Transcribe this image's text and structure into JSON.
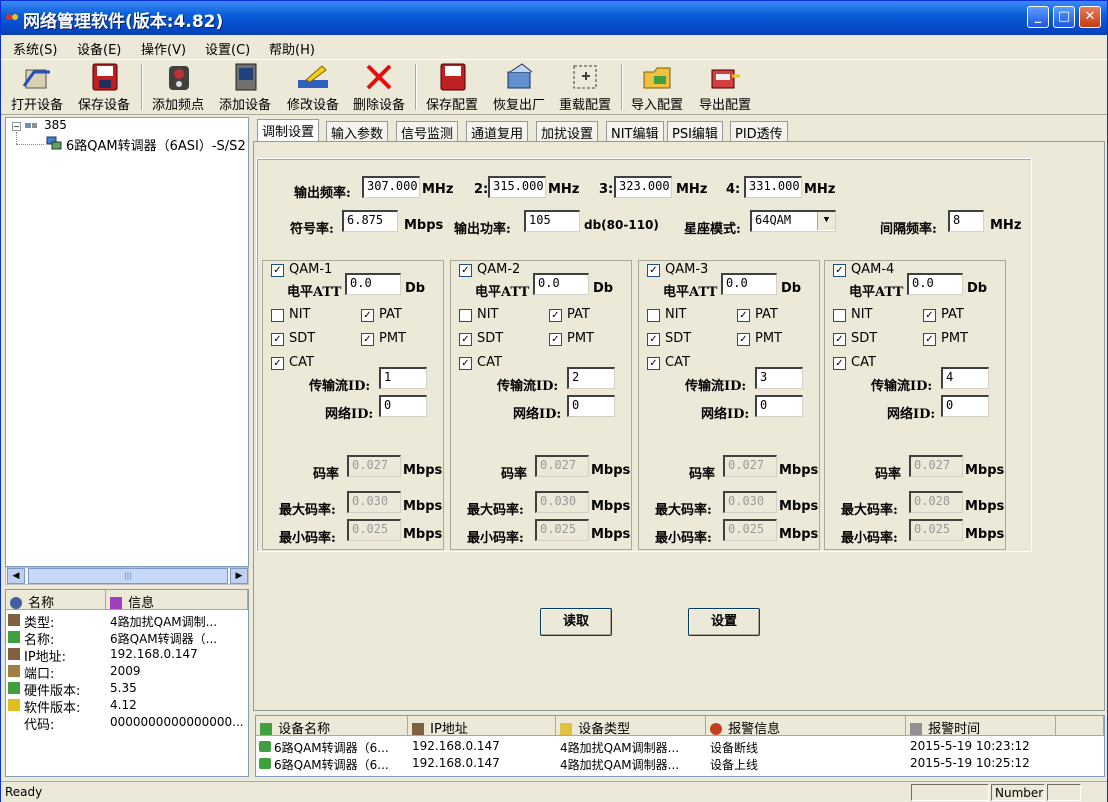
{
  "window": {
    "title": "网络管理软件(版本:4.82)"
  },
  "menu": [
    "系统(S)",
    "设备(E)",
    "操作(V)",
    "设置(C)",
    "帮助(H)"
  ],
  "toolbar": [
    "打开设备",
    "保存设备",
    "添加频点",
    "添加设备",
    "修改设备",
    "删除设备",
    "保存配置",
    "恢复出厂",
    "重载配置",
    "导入配置",
    "导出配置"
  ],
  "tree": {
    "root": "385",
    "child": "6路QAM转调器（6ASI）-S/S2"
  },
  "props": {
    "header": [
      "名称",
      "信息"
    ],
    "rows": [
      {
        "k": "类型:",
        "v": "4路加扰QAM调制..."
      },
      {
        "k": "名称:",
        "v": "6路QAM转调器（..."
      },
      {
        "k": "IP地址:",
        "v": "192.168.0.147"
      },
      {
        "k": "端口:",
        "v": "2009"
      },
      {
        "k": "硬件版本:",
        "v": "5.35"
      },
      {
        "k": "软件版本:",
        "v": "4.12"
      },
      {
        "k": "代码:",
        "v": "0000000000000000..."
      }
    ]
  },
  "tabs": [
    "调制设置",
    "输入参数",
    "信号监测",
    "通道复用",
    "加扰设置",
    "NIT编辑",
    "PSI编辑",
    "PID透传"
  ],
  "form": {
    "out_freq_label": "输出频率:",
    "f1": "307.000",
    "f2": "315.000",
    "f3": "323.000",
    "f4": "331.000",
    "n2": "2:",
    "n3": "3:",
    "n4": "4:",
    "mhz": "MHz",
    "sym_label": "符号率:",
    "sym": "6.875",
    "mbps": "Mbps",
    "power_label": "输出功率:",
    "power": "105",
    "power_unit": "db(80-110)",
    "const_label": "星座模式:",
    "const": "64QAM",
    "spacing_label": "间隔频率:",
    "spacing": "8"
  },
  "groups": [
    {
      "name": "QAM-1",
      "att": "0.0",
      "nit": false,
      "pat": true,
      "sdt": true,
      "pmt": true,
      "cat": true,
      "tsid": "1",
      "netid": "0",
      "rate": "0.027",
      "max": "0.030",
      "min": "0.025"
    },
    {
      "name": "QAM-2",
      "att": "0.0",
      "nit": false,
      "pat": true,
      "sdt": true,
      "pmt": true,
      "cat": true,
      "tsid": "2",
      "netid": "0",
      "rate": "0.027",
      "max": "0.030",
      "min": "0.025"
    },
    {
      "name": "QAM-3",
      "att": "0.0",
      "nit": false,
      "pat": true,
      "sdt": true,
      "pmt": true,
      "cat": true,
      "tsid": "3",
      "netid": "0",
      "rate": "0.027",
      "max": "0.030",
      "min": "0.025"
    },
    {
      "name": "QAM-4",
      "att": "0.0",
      "nit": false,
      "pat": true,
      "sdt": true,
      "pmt": true,
      "cat": true,
      "tsid": "4",
      "netid": "0",
      "rate": "0.027",
      "max": "0.028",
      "min": "0.025"
    }
  ],
  "glabels": {
    "att": "电平ATT",
    "db": "Db",
    "nit": "NIT",
    "pat": "PAT",
    "sdt": "SDT",
    "pmt": "PMT",
    "cat": "CAT",
    "tsid": "传输流ID:",
    "netid": "网络ID:",
    "rate": "码率",
    "max": "最大码率:",
    "min": "最小码率:",
    "mbps": "Mbps"
  },
  "buttons": {
    "read": "读取",
    "set": "设置"
  },
  "log": {
    "header": [
      "设备名称",
      "IP地址",
      "设备类型",
      "报警信息",
      "报警时间"
    ],
    "rows": [
      [
        "6路QAM转调器（6...",
        "192.168.0.147",
        "4路加扰QAM调制器...",
        "设备断线",
        "2015-5-19 10:23:12"
      ],
      [
        "6路QAM转调器（6...",
        "192.168.0.147",
        "4路加扰QAM调制器...",
        "设备上线",
        "2015-5-19 10:25:12"
      ]
    ]
  },
  "status": {
    "left": "Ready",
    "num": "Number"
  },
  "colors": {
    "title_blue": "#0449c9",
    "accent_red": "#e01010"
  }
}
